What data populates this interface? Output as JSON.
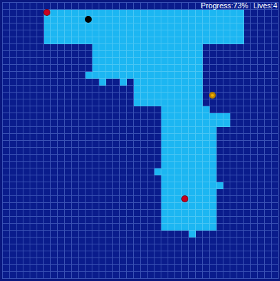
{
  "status": {
    "progress": "Progress:73%",
    "lives": "Lives:4"
  },
  "board": {
    "filled": [
      {
        "row": 1,
        "from": 6,
        "to": 34
      },
      {
        "row": 2,
        "from": 6,
        "to": 34
      },
      {
        "row": 3,
        "from": 6,
        "to": 34
      },
      {
        "row": 4,
        "from": 6,
        "to": 34
      },
      {
        "row": 5,
        "from": 6,
        "to": 34
      },
      {
        "row": 6,
        "from": 13,
        "to": 28
      },
      {
        "row": 7,
        "from": 13,
        "to": 28
      },
      {
        "row": 8,
        "from": 13,
        "to": 28
      },
      {
        "row": 9,
        "from": 13,
        "to": 28
      },
      {
        "row": 10,
        "from": 12,
        "to": 28
      },
      {
        "row": 11,
        "from": 14,
        "to": 14
      },
      {
        "row": 11,
        "from": 17,
        "to": 17
      },
      {
        "row": 11,
        "from": 19,
        "to": 28
      },
      {
        "row": 12,
        "from": 19,
        "to": 28
      },
      {
        "row": 13,
        "from": 19,
        "to": 28
      },
      {
        "row": 14,
        "from": 19,
        "to": 28
      },
      {
        "row": 15,
        "from": 23,
        "to": 29
      },
      {
        "row": 16,
        "from": 23,
        "to": 32
      },
      {
        "row": 17,
        "from": 23,
        "to": 32
      },
      {
        "row": 18,
        "from": 23,
        "to": 30
      },
      {
        "row": 19,
        "from": 23,
        "to": 30
      },
      {
        "row": 20,
        "from": 23,
        "to": 30
      },
      {
        "row": 21,
        "from": 23,
        "to": 30
      },
      {
        "row": 22,
        "from": 23,
        "to": 30
      },
      {
        "row": 23,
        "from": 23,
        "to": 30
      },
      {
        "row": 24,
        "from": 22,
        "to": 30
      },
      {
        "row": 25,
        "from": 23,
        "to": 30
      },
      {
        "row": 26,
        "from": 23,
        "to": 31
      },
      {
        "row": 27,
        "from": 23,
        "to": 30
      },
      {
        "row": 28,
        "from": 23,
        "to": 30
      },
      {
        "row": 29,
        "from": 23,
        "to": 30
      },
      {
        "row": 30,
        "from": 23,
        "to": 30
      },
      {
        "row": 31,
        "from": 23,
        "to": 30
      },
      {
        "row": 32,
        "from": 23,
        "to": 30
      },
      {
        "row": 33,
        "from": 27,
        "to": 27
      }
    ],
    "pieces": [
      {
        "kind": "enemy",
        "col": 6,
        "row": 1,
        "color": "#c8001e"
      },
      {
        "kind": "ball",
        "col": 12,
        "row": 2,
        "color": "#000000"
      },
      {
        "kind": "player",
        "col": 30,
        "row": 13,
        "color": "#f0b400"
      },
      {
        "kind": "enemy",
        "col": 26,
        "row": 28,
        "color": "#c8001e"
      }
    ]
  }
}
